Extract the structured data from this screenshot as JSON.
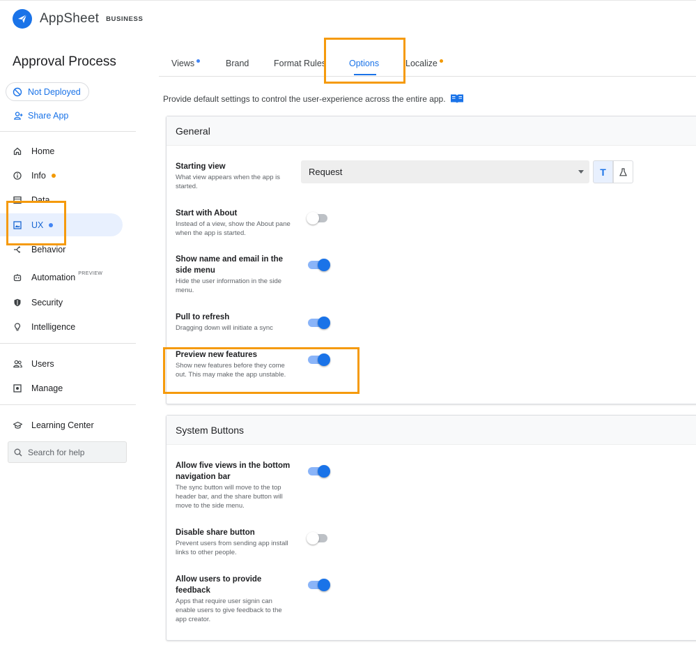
{
  "app": {
    "name": "AppSheet",
    "tier": "BUSINESS"
  },
  "sidebar": {
    "app_title": "Approval Process",
    "deploy_status": "Not Deployed",
    "share_label": "Share App",
    "items": [
      {
        "label": "Home",
        "icon": "home-icon"
      },
      {
        "label": "Info",
        "icon": "info-icon",
        "dot": "#f29900"
      },
      {
        "label": "Data",
        "icon": "data-icon"
      },
      {
        "label": "UX",
        "icon": "ux-icon",
        "dot": "#4285f4",
        "active": true
      },
      {
        "label": "Behavior",
        "icon": "behavior-icon"
      },
      {
        "label": "Automation",
        "icon": "automation-icon",
        "badge": "PREVIEW"
      },
      {
        "label": "Security",
        "icon": "shield-icon"
      },
      {
        "label": "Intelligence",
        "icon": "lightbulb-icon"
      },
      {
        "label": "Users",
        "icon": "users-icon"
      },
      {
        "label": "Manage",
        "icon": "manage-icon"
      },
      {
        "label": "Learning Center",
        "icon": "graduation-cap-icon"
      }
    ],
    "search_placeholder": "Search for help"
  },
  "tabs": [
    {
      "label": "Views",
      "dot": "#4285f4"
    },
    {
      "label": "Brand"
    },
    {
      "label": "Format Rules"
    },
    {
      "label": "Options",
      "active": true
    },
    {
      "label": "Localize",
      "dot": "#f29900"
    }
  ],
  "intro_text": "Provide default settings to control the user-experience across the entire app.",
  "general": {
    "title": "General",
    "starting_view": {
      "label": "Starting view",
      "desc": "What view appears when the app is started.",
      "value": "Request",
      "mode_text_icon": "T"
    },
    "settings": [
      {
        "label": "Start with About",
        "desc": "Instead of a view, show the About pane when the app is started.",
        "on": false
      },
      {
        "label": "Show name and email in the side menu",
        "desc": "Hide the user information in the side menu.",
        "on": true
      },
      {
        "label": "Pull to refresh",
        "desc": "Dragging down will initiate a sync",
        "on": true
      },
      {
        "label": "Preview new features",
        "desc": "Show new features before they come out. This may make the app unstable.",
        "on": true
      }
    ]
  },
  "system_buttons": {
    "title": "System Buttons",
    "settings": [
      {
        "label": "Allow five views in the bottom navigation bar",
        "desc": "The sync button will move to the top header bar, and the share button will move to the side menu.",
        "on": true
      },
      {
        "label": "Disable share button",
        "desc": "Prevent users from sending app install links to other people.",
        "on": false
      },
      {
        "label": "Allow users to provide feedback",
        "desc": "Apps that require user signin can enable users to give feedback to the app creator.",
        "on": true
      }
    ]
  },
  "colors": {
    "accent": "#1a73e8",
    "highlight": "#f59a0c",
    "info_dot": "#f29900",
    "ux_dot": "#4285f4"
  }
}
